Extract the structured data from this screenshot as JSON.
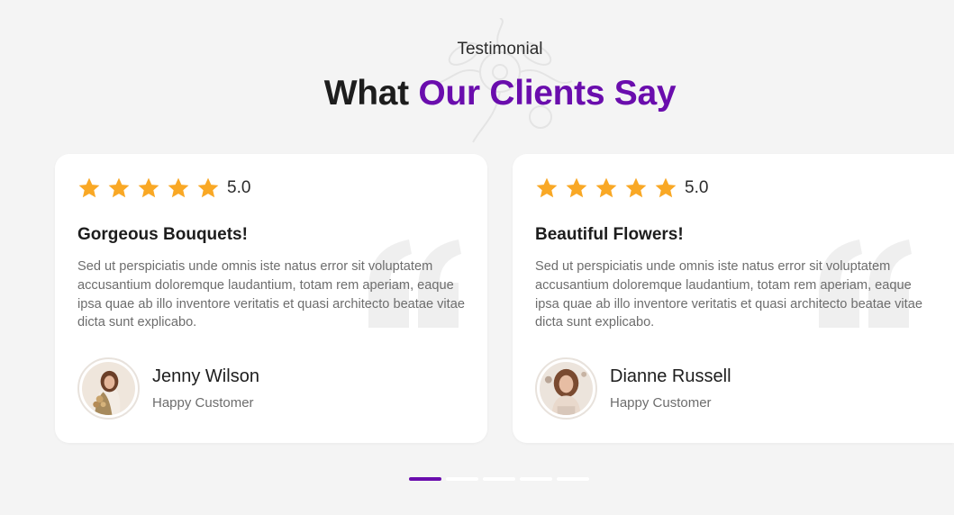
{
  "section": {
    "eyebrow": "Testimonial",
    "heading_prefix": "What ",
    "heading_accent": "Our Clients Say"
  },
  "colors": {
    "accent": "#6a0dad",
    "star": "#f9a825",
    "background": "#f4f4f4",
    "card": "#ffffff"
  },
  "testimonials": [
    {
      "rating": "5.0",
      "stars": 5,
      "title": "Gorgeous Bouquets!",
      "text": "Sed ut perspiciatis unde omnis iste natus error sit voluptatem accusantium doloremque laudantium, totam rem aperiam, eaque ipsa quae ab illo inventore veritatis et quasi architecto beatae vitae dicta sunt explicabo.",
      "name": "Jenny Wilson",
      "role": "Happy Customer"
    },
    {
      "rating": "5.0",
      "stars": 5,
      "title": "Beautiful Flowers!",
      "text": "Sed ut perspiciatis unde omnis iste natus error sit voluptatem accusantium doloremque laudantium, totam rem aperiam, eaque ipsa quae ab illo inventore veritatis et quasi architecto beatae vitae dicta sunt explicabo.",
      "name": "Dianne Russell",
      "role": "Happy Customer"
    }
  ],
  "pagination": {
    "count": 5,
    "active_index": 0
  }
}
